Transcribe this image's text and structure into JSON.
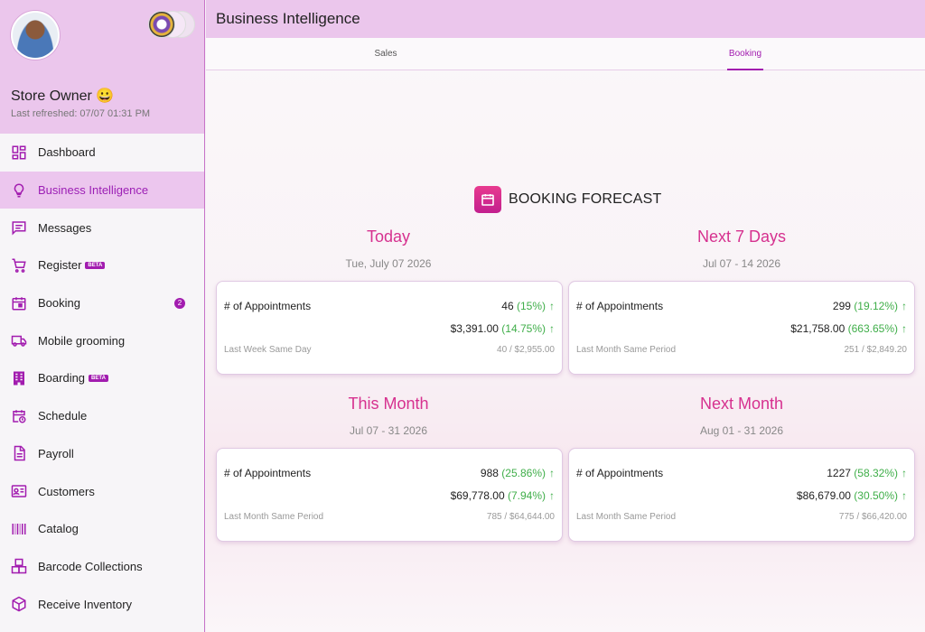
{
  "profile": {
    "name": "Store Owner 😀",
    "last_refreshed": "Last refreshed: 07/07 01:31 PM"
  },
  "sidebar": {
    "items": [
      {
        "label": "Dashboard",
        "icon": "dashboard-icon"
      },
      {
        "label": "Business Intelligence",
        "icon": "lightbulb-icon",
        "active": true
      },
      {
        "label": "Messages",
        "icon": "message-icon"
      },
      {
        "label": "Register",
        "icon": "cart-icon",
        "badge": "BETA"
      },
      {
        "label": "Booking",
        "icon": "calendar-icon",
        "count": "2"
      },
      {
        "label": "Mobile grooming",
        "icon": "van-icon"
      },
      {
        "label": "Boarding",
        "icon": "building-icon",
        "badge": "BETA"
      },
      {
        "label": "Schedule",
        "icon": "schedule-icon"
      },
      {
        "label": "Payroll",
        "icon": "document-icon"
      },
      {
        "label": "Customers",
        "icon": "id-card-icon"
      },
      {
        "label": "Catalog",
        "icon": "barcode-icon"
      },
      {
        "label": "Barcode Collections",
        "icon": "boxes-icon"
      },
      {
        "label": "Receive Inventory",
        "icon": "package-icon"
      }
    ]
  },
  "header": {
    "title": "Business Intelligence"
  },
  "tabs": [
    {
      "label": "Sales",
      "active": false
    },
    {
      "label": "Booking",
      "active": true
    }
  ],
  "forecast": {
    "title": "BOOKING FORECAST",
    "periods": [
      {
        "title": "Today",
        "date": "Tue, July 07 2026",
        "appointments_label": "# of Appointments",
        "appointments": "46",
        "appointments_pct": "(15%)",
        "revenue": "$3,391.00",
        "revenue_pct": "(14.75%)",
        "compare_label": "Last Week Same Day",
        "compare_value": "40 / $2,955.00"
      },
      {
        "title": "Next 7 Days",
        "date": "Jul 07 - 14 2026",
        "appointments_label": "# of Appointments",
        "appointments": "299",
        "appointments_pct": "(19.12%)",
        "revenue": "$21,758.00",
        "revenue_pct": "(663.65%)",
        "compare_label": "Last Month Same Period",
        "compare_value": "251 / $2,849.20"
      },
      {
        "title": "This Month",
        "date": "Jul 07 - 31 2026",
        "appointments_label": "# of Appointments",
        "appointments": "988",
        "appointments_pct": "(25.86%)",
        "revenue": "$69,778.00",
        "revenue_pct": "(7.94%)",
        "compare_label": "Last Month Same Period",
        "compare_value": "785 / $64,644.00"
      },
      {
        "title": "Next Month",
        "date": "Aug 01 - 31 2026",
        "appointments_label": "# of Appointments",
        "appointments": "1227",
        "appointments_pct": "(58.32%)",
        "revenue": "$86,679.00",
        "revenue_pct": "(30.50%)",
        "compare_label": "Last Month Same Period",
        "compare_value": "775 / $66,420.00"
      }
    ]
  },
  "colors": {
    "accent": "#a21caf",
    "title_pink": "#d6318f",
    "positive": "#3fae49",
    "header_bg": "#ebc6ec"
  }
}
